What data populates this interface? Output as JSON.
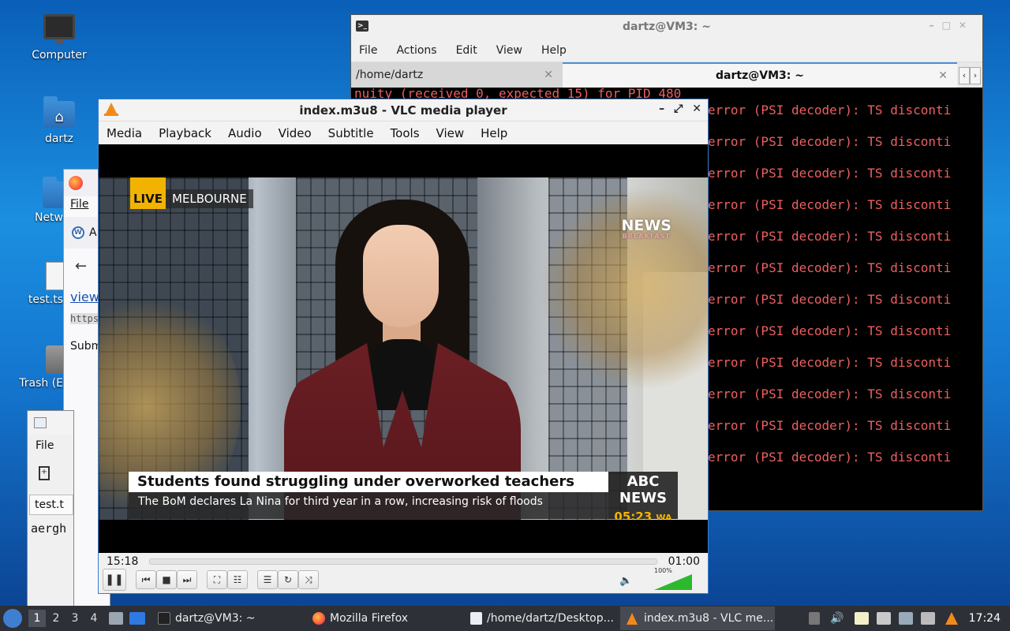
{
  "desktop": {
    "icons": [
      {
        "label": "Computer"
      },
      {
        "label": "dartz"
      },
      {
        "label": "Netw"
      },
      {
        "label": "test.ts"
      },
      {
        "label": "Trash (E"
      }
    ]
  },
  "terminal": {
    "title": "dartz@VM3: ~",
    "menu": [
      "File",
      "Actions",
      "Edit",
      "View",
      "Help"
    ],
    "tabs": [
      {
        "label": "/home/dartz"
      },
      {
        "label": "dartz@VM3: ~"
      }
    ],
    "first_line": "nuity (received 0, expected 15) for PID 480",
    "error_line": "error (PSI decoder): TS disconti",
    "error_count": 12
  },
  "firefox": {
    "menu_file": "File",
    "tab_stub": "A",
    "link_stub": "view",
    "url_stub": "https",
    "submit_stub": "Subm"
  },
  "mousepad": {
    "menu_file": "File",
    "tab_stub": "test.t",
    "text_stub": "aergh"
  },
  "vlc": {
    "title": "index.m3u8 - VLC media player",
    "menu": [
      "Media",
      "Playback",
      "Audio",
      "Video",
      "Subtitle",
      "Tools",
      "View",
      "Help"
    ],
    "video": {
      "live_tag": "LIVE",
      "location": "MELBOURNE",
      "bug_top": "NEWS",
      "bug_bottom": "BREAKFAST",
      "headline": "Students found struggling under overworked teachers",
      "ticker": "The BoM declares La Nina for third year in a row, increasing risk of floods",
      "brand": "ABC NEWS",
      "time": "05:23",
      "time_zone": "WA"
    },
    "elapsed": "15:18",
    "remaining": "01:00",
    "volume_label": "100%",
    "volume_level": 1.0
  },
  "taskbar": {
    "workspaces": [
      "1",
      "2",
      "3",
      "4"
    ],
    "tasks": [
      {
        "label": "dartz@VM3: ~"
      },
      {
        "label": "Mozilla Firefox"
      },
      {
        "label": "/home/dartz/Desktop..."
      },
      {
        "label": "index.m3u8 - VLC me..."
      }
    ],
    "clock": "17:24"
  },
  "colors": {
    "terminal_error": "#ef5f5f",
    "vlc_accent": "#f28a1b",
    "abc_yellow": "#f2b300",
    "volume_green": "#2db82d"
  }
}
